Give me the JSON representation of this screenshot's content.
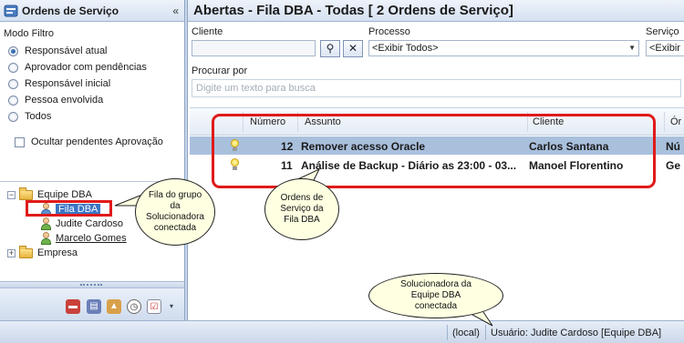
{
  "left_panel": {
    "title": "Ordens de Serviço",
    "collapse_glyph": "«",
    "mode_label": "Modo Filtro",
    "filters": [
      {
        "label": "Responsável atual",
        "checked": true
      },
      {
        "label": "Aprovador com pendências",
        "checked": false
      },
      {
        "label": "Responsável inicial",
        "checked": false
      },
      {
        "label": "Pessoa envolvida",
        "checked": false
      },
      {
        "label": "Todos",
        "checked": false
      }
    ],
    "hide_pending_label": "Ocultar pendentes Aprovação",
    "tree": {
      "group1": {
        "label": "Equipe DBA",
        "expander": "−"
      },
      "queue": {
        "label": "Fila DBA"
      },
      "user1": {
        "label": "Judite Cardoso"
      },
      "user2": {
        "label": "Marcelo Gomes"
      },
      "group2": {
        "label": "Empresa",
        "expander": "+"
      }
    },
    "toolbar_icons": [
      "toolbox-icon",
      "book-icon",
      "chart-icon",
      "clock-icon",
      "checklist-icon",
      "dropdown-arrow-icon"
    ]
  },
  "main": {
    "title": "Abertas - Fila DBA - Todas [ 2 Ordens de Serviço]",
    "client_label": "Cliente",
    "process_label": "Processo",
    "process_value": "<Exibir Todos>",
    "service_label": "Serviço",
    "service_value": "<Exibir",
    "search_label": "Procurar por",
    "search_placeholder": "Digite um texto para busca",
    "binoculars_glyph": "⚲",
    "clear_glyph": "✕",
    "columns": {
      "numero": "Número",
      "assunto": "Assunto",
      "cliente": "Cliente",
      "extra": "Ór"
    },
    "rows": [
      {
        "numero": "12",
        "assunto": "Remover acesso Oracle",
        "cliente": "Carlos Santana",
        "extra": "Nú"
      },
      {
        "numero": "11",
        "assunto": "Análise de Backup - Diário as 23:00 - 03...",
        "cliente": "Manoel Florentino",
        "extra": "Ge"
      }
    ]
  },
  "callouts": {
    "fila": "Fila do grupo da Solucionadora conectada",
    "ordens": "Ordens de Serviço da Fila DBA",
    "solucionadora": "Solucionadora da Equipe DBA conectada"
  },
  "statusbar": {
    "connection": "(local)",
    "user": "Usuário: Judite Cardoso [Equipe DBA]"
  },
  "colors": {
    "selection": "#3a75c4",
    "annotation_red": "#e01a1a",
    "callout_fill": "#ffffe1"
  }
}
